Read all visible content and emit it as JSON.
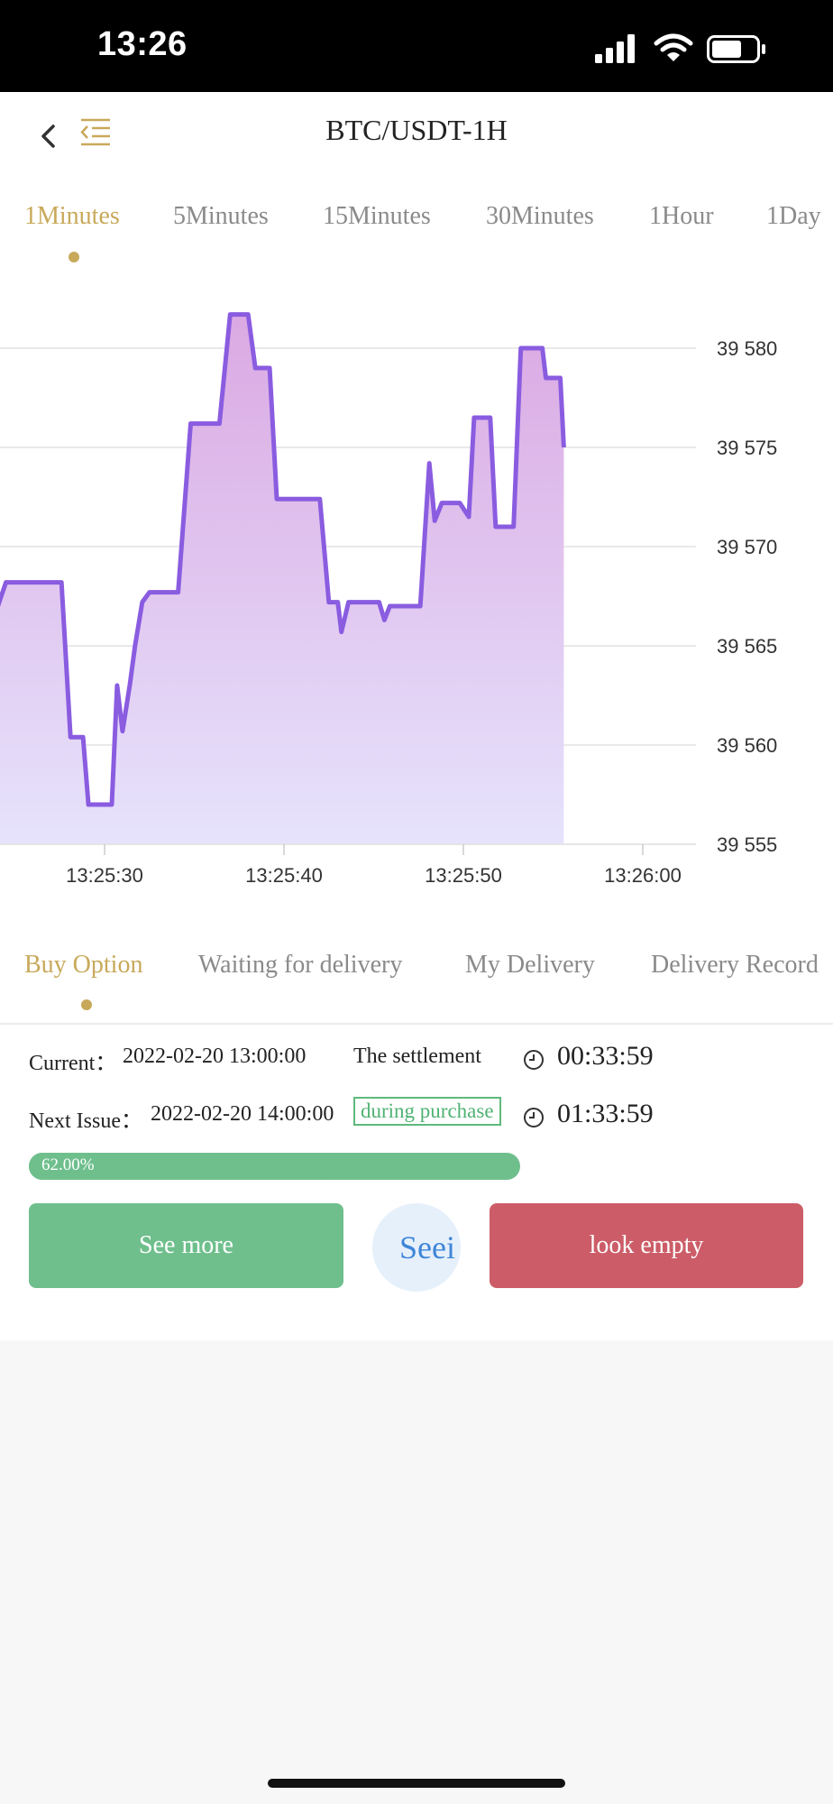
{
  "status_bar": {
    "time": "13:26"
  },
  "header": {
    "title": "BTC/USDT-1H"
  },
  "timeframe_tabs": [
    {
      "label": "1Minutes",
      "active": true
    },
    {
      "label": "5Minutes",
      "active": false
    },
    {
      "label": "15Minutes",
      "active": false
    },
    {
      "label": "30Minutes",
      "active": false
    },
    {
      "label": "1Hour",
      "active": false
    },
    {
      "label": "1Day",
      "active": false
    }
  ],
  "chart_data": {
    "type": "area",
    "y_ticks": [
      "39 580",
      "39 575",
      "39 570",
      "39 565",
      "39 560",
      "39 555"
    ],
    "x_ticks": [
      "13:25:30",
      "13:25:40",
      "13:25:50",
      "13:26:00"
    ],
    "ylim": [
      39555,
      39580
    ],
    "grid": true,
    "colors": {
      "line": "#8a5ce0",
      "fill_top": "#dba9e3",
      "fill_bottom": "#e6e3fc"
    },
    "series": [
      {
        "points": [
          [
            13.5,
            39569.8
          ],
          [
            13.9,
            39569.5
          ],
          [
            14.2,
            39562.0
          ],
          [
            14.4,
            39561.5
          ],
          [
            14.8,
            39567.4
          ],
          [
            15.2,
            39564.2
          ],
          [
            15.6,
            39566.4
          ],
          [
            16.2,
            39566.2
          ],
          [
            17.2,
            39567.0
          ],
          [
            17.7,
            39569.6
          ],
          [
            18.4,
            39570.0
          ],
          [
            19.2,
            39575.0
          ],
          [
            19.6,
            39577.6
          ],
          [
            20.4,
            39577.6
          ],
          [
            21.0,
            39575.2
          ],
          [
            22.4,
            39575.2
          ],
          [
            23.0,
            39570.8
          ],
          [
            23.5,
            39566.7
          ],
          [
            23.9,
            39566.6
          ],
          [
            24.5,
            39568.2
          ],
          [
            27.6,
            39568.2
          ],
          [
            28.1,
            39560.4
          ],
          [
            28.8,
            39560.4
          ],
          [
            29.1,
            39557.0
          ],
          [
            30.4,
            39557.0
          ],
          [
            30.7,
            39563.0
          ],
          [
            31.0,
            39560.7
          ],
          [
            31.4,
            39563.0
          ],
          [
            31.7,
            39565.0
          ],
          [
            32.1,
            39567.2
          ],
          [
            32.5,
            39567.7
          ],
          [
            34.1,
            39567.7
          ],
          [
            34.8,
            39576.2
          ],
          [
            36.4,
            39576.2
          ],
          [
            37.0,
            39581.7
          ],
          [
            38.0,
            39581.7
          ],
          [
            38.4,
            39579.0
          ],
          [
            39.2,
            39579.0
          ],
          [
            39.6,
            39572.4
          ],
          [
            41.0,
            39572.4
          ],
          [
            42.0,
            39572.4
          ],
          [
            42.5,
            39567.2
          ],
          [
            43.0,
            39567.2
          ],
          [
            43.2,
            39565.7
          ],
          [
            43.6,
            39567.2
          ],
          [
            45.3,
            39567.2
          ],
          [
            45.6,
            39566.3
          ],
          [
            45.9,
            39567.0
          ],
          [
            47.6,
            39567.0
          ],
          [
            48.1,
            39574.2
          ],
          [
            48.4,
            39571.3
          ],
          [
            48.8,
            39572.2
          ],
          [
            49.8,
            39572.2
          ],
          [
            50.3,
            39571.5
          ],
          [
            50.6,
            39576.5
          ],
          [
            51.5,
            39576.5
          ],
          [
            51.8,
            39571.0
          ],
          [
            52.8,
            39571.0
          ],
          [
            53.2,
            39580.0
          ],
          [
            54.4,
            39580.0
          ],
          [
            54.6,
            39578.5
          ],
          [
            55.4,
            39578.5
          ],
          [
            55.6,
            39575.0
          ]
        ]
      }
    ]
  },
  "order_tabs": [
    {
      "label": "Buy Option",
      "active": true
    },
    {
      "label": "Waiting for delivery",
      "active": false
    },
    {
      "label": "My Delivery",
      "active": false
    },
    {
      "label": "Delivery Record",
      "active": false
    }
  ],
  "current_issue": {
    "label": "Current：",
    "datetime": "2022-02-20 13:00:00",
    "status": "The settlement",
    "countdown": "00:33:59"
  },
  "next_issue": {
    "label": "Next Issue：",
    "datetime": "2022-02-20 14:00:00",
    "status": "during purchase",
    "countdown": "01:33:59"
  },
  "progress": {
    "value": 0.62,
    "label": "62.00%"
  },
  "actions": {
    "see_more": "See more",
    "seek": "Seei",
    "look_empty": "look empty"
  },
  "colors": {
    "accent_gold": "#c8a95a",
    "buy_green": "#6fbf8d",
    "sell_red": "#cc5d68"
  }
}
